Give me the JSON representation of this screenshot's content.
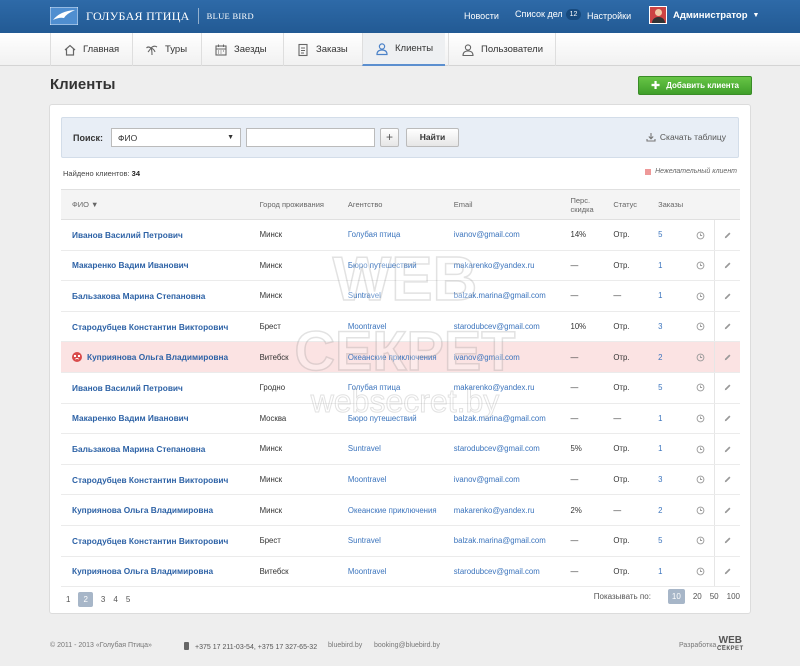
{
  "header": {
    "logo_ru": "ГОЛУБАЯ ПТИЦА",
    "logo_en": "BLUE BIRD",
    "links": {
      "news": "Новости",
      "todo": "Список дел",
      "todo_count": "12",
      "settings": "Настройки"
    },
    "user": "Администратор"
  },
  "nav": [
    {
      "label": "Главная",
      "icon": "home-icon"
    },
    {
      "label": "Туры",
      "icon": "palm-icon"
    },
    {
      "label": "Заезды",
      "icon": "calendar-icon"
    },
    {
      "label": "Заказы",
      "icon": "document-icon"
    },
    {
      "label": "Клиенты",
      "icon": "user-icon",
      "active": true
    },
    {
      "label": "Пользователи",
      "icon": "users-icon"
    }
  ],
  "page": {
    "title": "Клиенты",
    "add_button": "Добавить клиента"
  },
  "search": {
    "label": "Поиск:",
    "field": "ФИО",
    "input_value": "",
    "find_button": "Найти",
    "download": "Скачать таблицу"
  },
  "summary": {
    "found_label": "Найдено клиентов:",
    "found_count": "34",
    "legend": "Нежелательный клиент"
  },
  "table": {
    "headers": {
      "name": "ФИО ▼",
      "city": "Город проживания",
      "agency": "Агентство",
      "email": "Email",
      "discount_1": "Перс.",
      "discount_2": "скидка",
      "status": "Статус",
      "orders": "Заказы"
    },
    "rows": [
      {
        "name": "Иванов Василий Петрович",
        "city": "Минск",
        "agency": "Голубая птица",
        "email": "ivanov@gmail.com",
        "discount": "14%",
        "status": "Отр.",
        "orders": "5",
        "bad": false
      },
      {
        "name": "Макаренко Вадим Иванович",
        "city": "Минск",
        "agency": "Бюро путешествий",
        "email": "makarenko@yandex.ru",
        "discount": "—",
        "status": "Отр.",
        "orders": "1",
        "bad": false
      },
      {
        "name": "Бальзакова Марина Степановна",
        "city": "Минск",
        "agency": "Suntravel",
        "email": "balzak.marina@gmail.com",
        "discount": "—",
        "status": "—",
        "orders": "1",
        "bad": false
      },
      {
        "name": "Стародубцев Константин Викторович",
        "city": "Брест",
        "agency": "Moontravel",
        "email": "starodubcev@gmail.com",
        "discount": "10%",
        "status": "Отр.",
        "orders": "3",
        "bad": false
      },
      {
        "name": "Куприянова Ольга Владимировна",
        "city": "Витебск",
        "agency": "Океанские приключения",
        "email": "ivanov@gmail.com",
        "discount": "—",
        "status": "Отр.",
        "orders": "2",
        "bad": true
      },
      {
        "name": "Иванов Василий Петрович",
        "city": "Гродно",
        "agency": "Голубая птица",
        "email": "makarenko@yandex.ru",
        "discount": "—",
        "status": "Отр.",
        "orders": "5",
        "bad": false
      },
      {
        "name": "Макаренко Вадим Иванович",
        "city": "Москва",
        "agency": "Бюро путешествий",
        "email": "balzak.marina@gmail.com",
        "discount": "—",
        "status": "—",
        "orders": "1",
        "bad": false
      },
      {
        "name": "Бальзакова Марина Степановна",
        "city": "Минск",
        "agency": "Suntravel",
        "email": "starodubcev@gmail.com",
        "discount": "5%",
        "status": "Отр.",
        "orders": "1",
        "bad": false
      },
      {
        "name": "Стародубцев Константин Викторович",
        "city": "Минск",
        "agency": "Moontravel",
        "email": "ivanov@gmail.com",
        "discount": "—",
        "status": "Отр.",
        "orders": "3",
        "bad": false
      },
      {
        "name": "Куприянова Ольга Владимировна",
        "city": "Минск",
        "agency": "Океанские приключения",
        "email": "makarenko@yandex.ru",
        "discount": "2%",
        "status": "—",
        "orders": "2",
        "bad": false
      },
      {
        "name": "Стародубцев Константин Викторович",
        "city": "Брест",
        "agency": "Suntravel",
        "email": "balzak.marina@gmail.com",
        "discount": "—",
        "status": "Отр.",
        "orders": "5",
        "bad": false
      },
      {
        "name": "Куприянова Ольга Владимировна",
        "city": "Витебск",
        "agency": "Moontravel",
        "email": "starodubcev@gmail.com",
        "discount": "—",
        "status": "Отр.",
        "orders": "1",
        "bad": false
      }
    ]
  },
  "pagination": {
    "pages": [
      "1",
      "2",
      "3",
      "4",
      "5"
    ],
    "current": "2",
    "per_label": "Показывать по:",
    "per_options": [
      "10",
      "20",
      "50",
      "100"
    ],
    "per_current": "10"
  },
  "footer": {
    "copyright": "© 2011 - 2013 «Голубая Птица»",
    "phones": "+375 17 211-03-54, +375 17 327-65-32",
    "site": "bluebird.by",
    "email": "booking@bluebird.by",
    "dev_label": "Разработка —",
    "dev_logo_1": "WEB",
    "dev_logo_2": "СЕКРЕТ"
  },
  "watermark": {
    "line1": "WEB",
    "line2": "СЕКРЕТ",
    "line3": "websecret.by"
  },
  "colors": {
    "topbar": "#2e6aa8",
    "accent": "#2d62a6",
    "add_button": "#4fae33",
    "bad_row": "#fbe3e3"
  }
}
